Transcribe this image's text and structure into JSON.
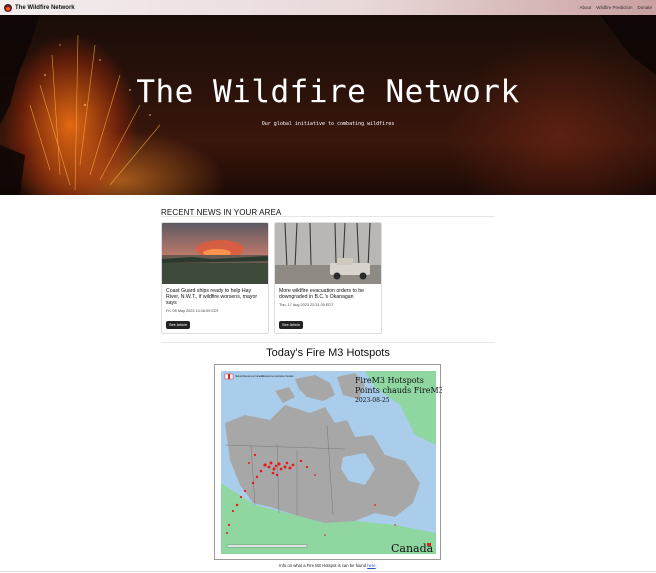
{
  "nav": {
    "brand": "The Wildfire Network",
    "links": [
      "About",
      "Wildfire Prediction",
      "Donate"
    ]
  },
  "hero": {
    "title": "The Wildfire Network",
    "subtitle": "Our global initiative to combating wildfires"
  },
  "news": {
    "heading": "RECENT NEWS IN YOUR AREA",
    "articles": [
      {
        "title": "Coast Guard ships ready to help Hay River, N.W.T., if wildfire worsens, mayor says",
        "date": "Fri, 05 May 2023 14:16:09 EDT",
        "button": "See Article"
      },
      {
        "title": "More wildfire evacuation orders to be downgraded in B.C.'s Okanagan",
        "date": "Thu, 17 Aug 2023 22:31:30 EDT",
        "button": "See Article"
      }
    ]
  },
  "hotspots": {
    "heading": "Today's Fire M3 Hotspots",
    "map": {
      "title_en": "FireM3 Hotspots",
      "title_fr": "Points chauds FireM3",
      "date": "2023-08-25",
      "agency_en": "Natural Resources Canada",
      "agency_fr": "Ressources naturelles Canada",
      "wordmark": "Canada"
    },
    "caption_prefix": "Info on what a Fire M3 Hotspot is can be found ",
    "caption_link": "here",
    "caption_suffix": "."
  },
  "colors": {
    "button": "#222222",
    "link": "#1a55cc",
    "map_water": "#a9cdea",
    "map_land": "#a7a7a7",
    "map_us": "#8fd6a0",
    "hotspot": "#e41a1a"
  }
}
